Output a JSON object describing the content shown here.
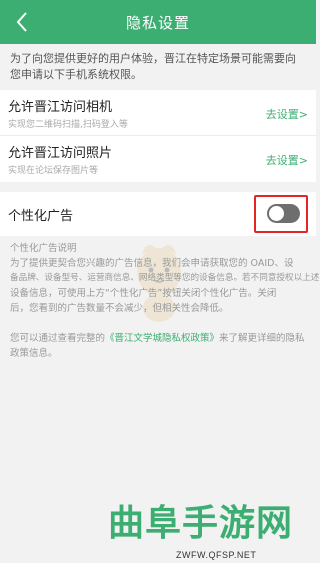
{
  "header": {
    "title": "隐私设置",
    "background": "#3dae72",
    "back_icon": "chevron-left-icon"
  },
  "intro": "为了向您提供更好的用户体验，晋江在特定场景可能需要向您申请以下手机系统权限。",
  "permissions": [
    {
      "title": "允许晋江访问相机",
      "desc": "实现您二维码扫描,扫码登入等",
      "action": "去设置>"
    },
    {
      "title": "允许晋江访问照片",
      "desc": "实现在论坛保存图片等",
      "action": "去设置>"
    }
  ],
  "ad_setting": {
    "title": "个性化广告",
    "toggle_state": "off",
    "highlight_color": "#e52424",
    "explain_heading": "个性化广告说明",
    "explain_lines": [
      "为了提供更契合您兴趣的广告信息，我们会申请获取您的 OAID、设",
      "备品牌、设备型号、运营商信息、网络类型等您的设备信息。若不同意授权以上述",
      "设备信息，可使用上方“个性化广告”按钮关闭个性化广告。关闭",
      "后，您看到的广告数量不会减少，但相关性会降低。"
    ]
  },
  "policy": {
    "prefix": "您可以通过查看完整的",
    "link": "《晋江文学城隐私权政策》",
    "suffix": "来了解更详细的隐私政策信息。"
  },
  "watermark": {
    "title": "曲阜手游网",
    "url": "ZWFW.QFSP.NET"
  },
  "colors": {
    "accent": "#3dae72",
    "background": "#f2f2f2",
    "toggle_off": "#6e6e6e"
  }
}
